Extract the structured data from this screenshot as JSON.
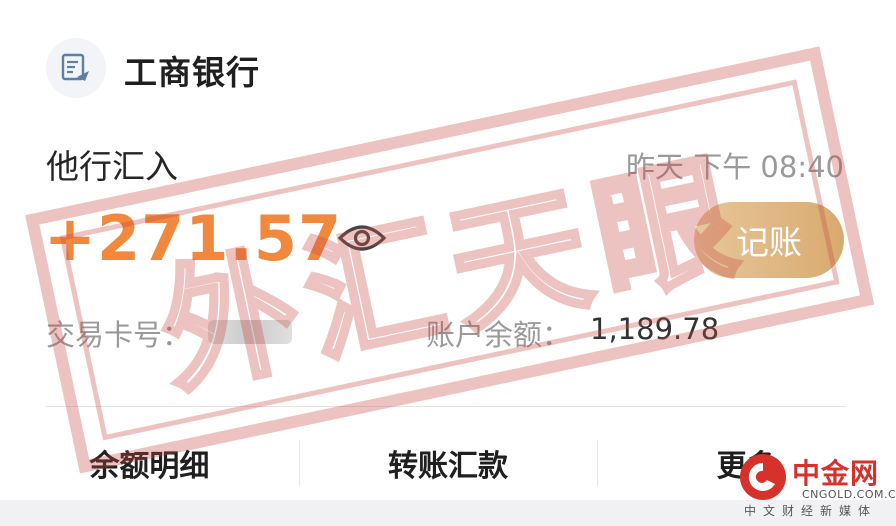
{
  "bank": {
    "name": "工商银行",
    "icon": "bank-doc-icon"
  },
  "transaction": {
    "type": "他行汇入",
    "time": "昨天 下午 08:40",
    "amount": "+271.57",
    "record_label": "记账",
    "card_label": "交易卡号：",
    "balance_label": "账户余额：",
    "balance": "1,189.78"
  },
  "actions": [
    {
      "label": "余额明细"
    },
    {
      "label": "转账汇款"
    },
    {
      "label": "更多"
    }
  ],
  "watermark": {
    "text": "外汇天眼"
  },
  "site_logo": {
    "name": "中金网",
    "domain": "CNGOLD.COM.CN",
    "slogan": "中文财经新媒体"
  },
  "colors": {
    "amount": "#f0893e",
    "record_button": "#dfb47d",
    "stamp": "#c94b47",
    "logo": "#d6312b"
  }
}
